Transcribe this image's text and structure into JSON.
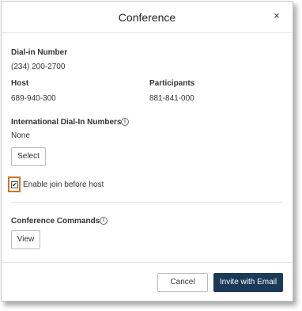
{
  "dialog": {
    "title": "Conference",
    "close_glyph": "×"
  },
  "dial_in": {
    "label": "Dial-in Number",
    "value": "(234) 200-2700"
  },
  "host": {
    "label": "Host",
    "value": "689-940-300"
  },
  "participants": {
    "label": "Participants",
    "value": "881-841-000"
  },
  "international": {
    "label": "International Dial-In Numbers",
    "value": "None",
    "info_glyph": "i",
    "select_label": "Select"
  },
  "join_before_host": {
    "label": "Enable join before host",
    "checked": true,
    "check_glyph": "✔"
  },
  "conference_commands": {
    "label": "Conference Commands",
    "info_glyph": "i",
    "view_label": "View"
  },
  "footer": {
    "cancel_label": "Cancel",
    "invite_label": "Invite with Email"
  },
  "colors": {
    "primary": "#1b3a57",
    "highlight": "#d9731e"
  },
  "icons": {
    "close": "close-icon",
    "info": "info-icon",
    "checkbox": "checkmark-icon"
  }
}
